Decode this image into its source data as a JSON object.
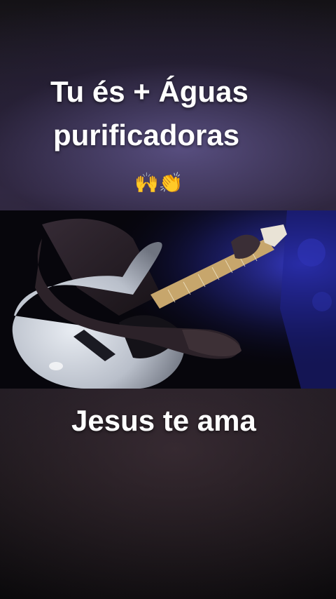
{
  "caption": {
    "line1": "Tu és + Águas",
    "line2": "purificadoras",
    "emojis": "🙌👏",
    "bottom": "Jesus te ama"
  },
  "video": {
    "subject": "guitarist-playing-electric-guitar",
    "stage_light_color": "#3a3fd8"
  }
}
